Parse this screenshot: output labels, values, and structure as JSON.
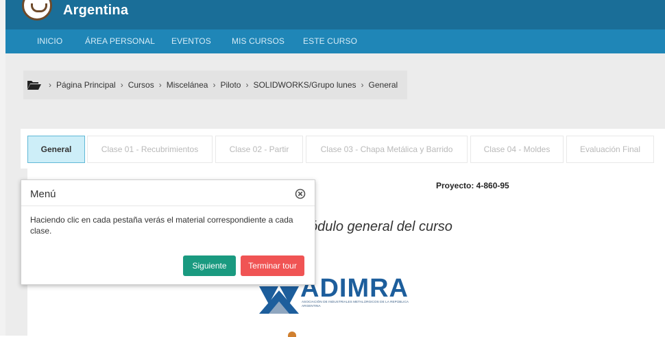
{
  "header": {
    "site_name": "Argentina"
  },
  "nav": {
    "items": [
      "INICIO",
      "ÁREA PERSONAL",
      "EVENTOS",
      "MIS CURSOS",
      "ESTE CURSO"
    ]
  },
  "breadcrumb": {
    "items": [
      "Página Principal",
      "Cursos",
      "Miscelánea",
      "Piloto",
      "SOLIDWORKS/Grupo lunes",
      "General"
    ]
  },
  "tabs": [
    {
      "label": "General",
      "active": true
    },
    {
      "label": "Clase 01 - Recubrimientos",
      "active": false
    },
    {
      "label": "Clase 02 - Partir",
      "active": false
    },
    {
      "label": "Clase 03 - Chapa Metálica y Barrido",
      "active": false
    },
    {
      "label": "Clase 04 - Moldes",
      "active": false
    },
    {
      "label": "Evaluación Final",
      "active": false
    }
  ],
  "content": {
    "project_code": "Proyecto: 4-860-95",
    "module_title": "ódulo general del curso"
  },
  "logo": {
    "word": "ADIMRA",
    "subtitle": "ASOCIACIÓN DE INDUSTRIALES METALÚRGICOS DE LA REPÚBLICA ARGENTINA"
  },
  "tour": {
    "title": "Menú",
    "body": "Haciendo clic en cada pestaña verás el material correspondiente a cada clase.",
    "next_label": "Siguiente",
    "end_label": "Terminar tour"
  },
  "colors": {
    "topbar": "#1a6e98",
    "navbar": "#1f86b7",
    "active_tab": "#cdeef8",
    "next_button": "#1a9a80",
    "end_button": "#f05454"
  }
}
